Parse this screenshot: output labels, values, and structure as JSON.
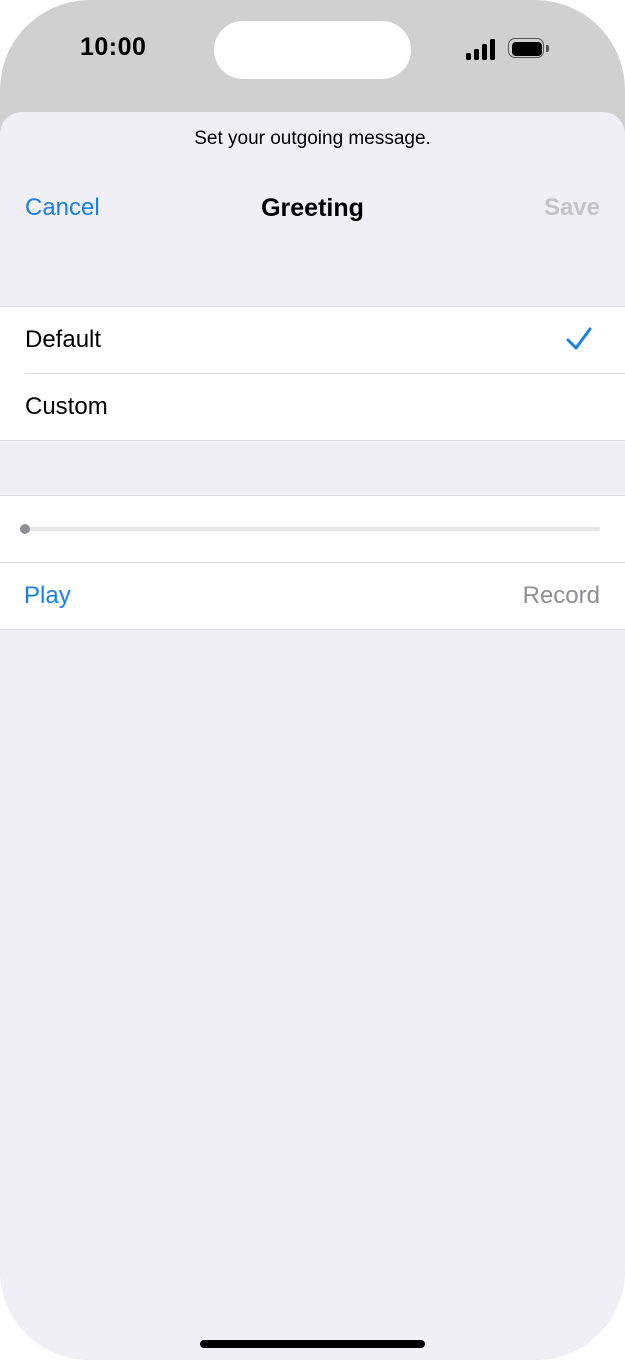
{
  "status_bar": {
    "time": "10:00",
    "signal_icon": "cellular-signal-icon",
    "battery_icon": "battery-icon"
  },
  "sheet": {
    "prompt": "Set your outgoing message.",
    "nav": {
      "cancel_label": "Cancel",
      "title": "Greeting",
      "save_label": "Save"
    },
    "options": [
      {
        "label": "Default",
        "selected": true
      },
      {
        "label": "Custom",
        "selected": false
      }
    ],
    "player": {
      "progress": 0,
      "play_label": "Play",
      "record_label": "Record"
    }
  },
  "colors": {
    "accent": "#1a7fe6",
    "disabled": "#c4c4c8",
    "secondary_text": "#8e8e93",
    "grouped_background": "#f0eff5"
  }
}
